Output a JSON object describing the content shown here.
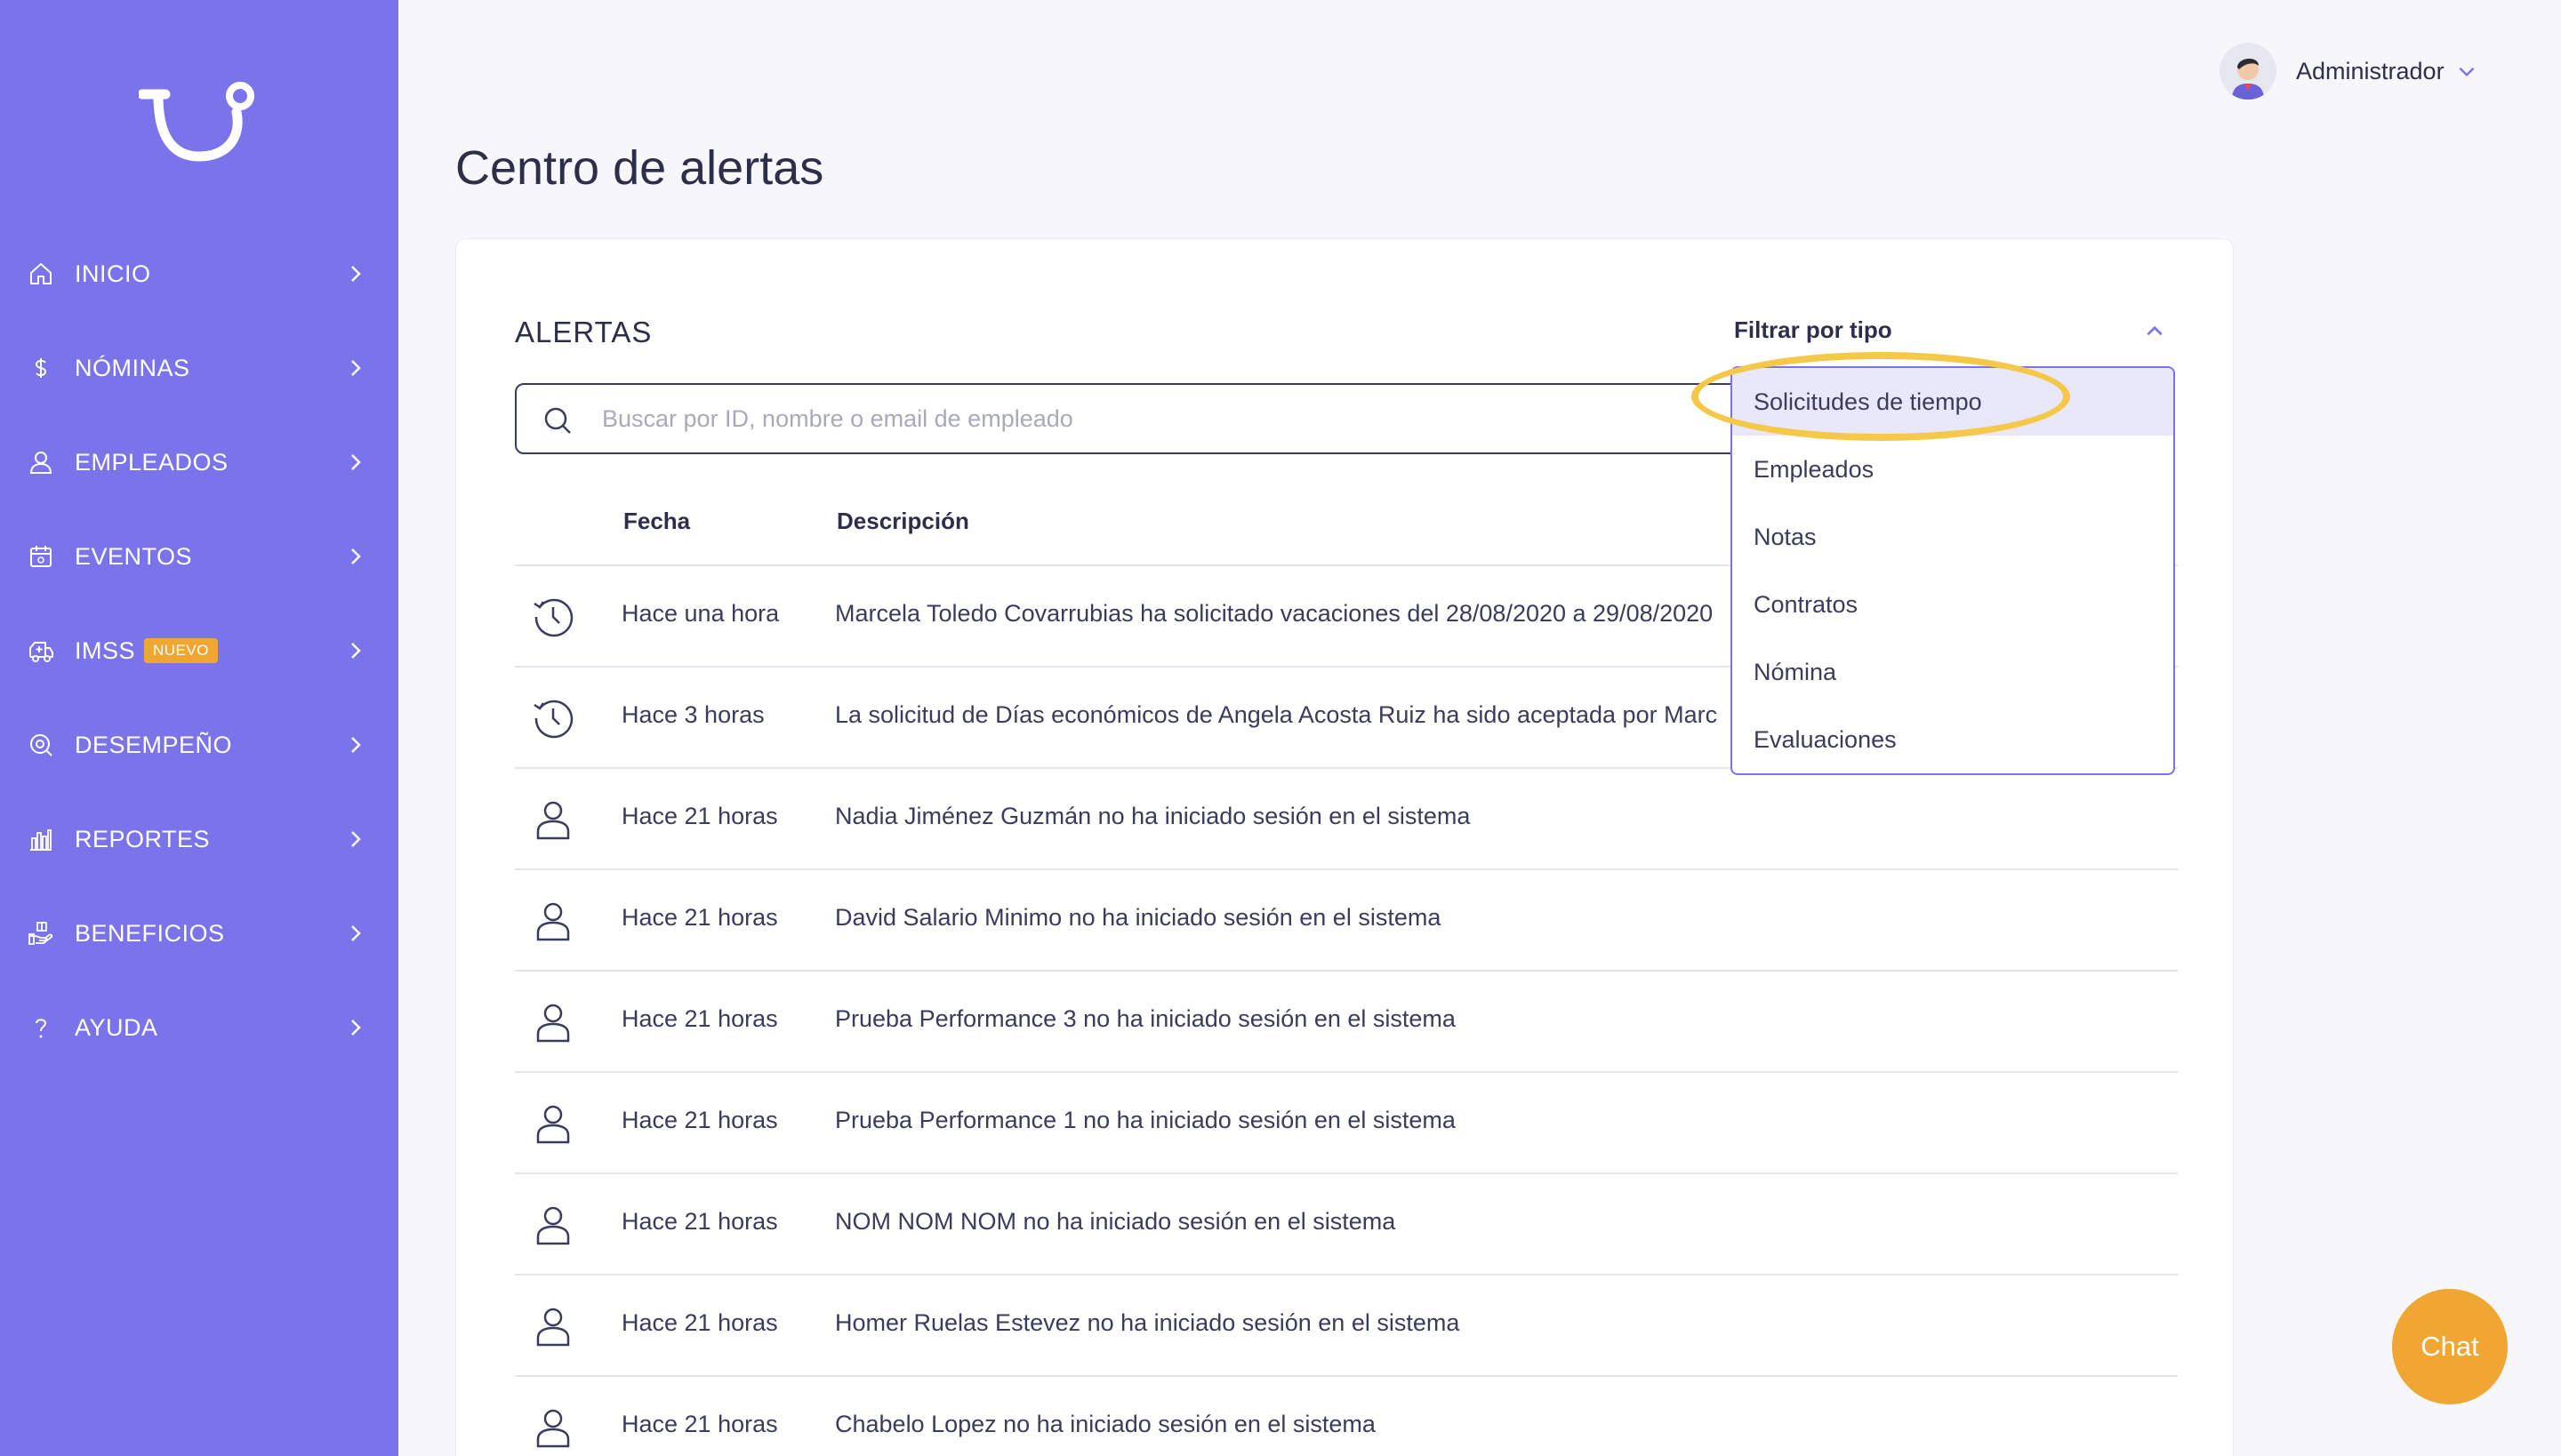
{
  "app": {
    "brand_color": "#7b73ea",
    "accent_color": "#f0a632",
    "highlight_color": "#f5c84a"
  },
  "sidebar": {
    "items": [
      {
        "label": "INICIO",
        "icon": "home-icon"
      },
      {
        "label": "NÓMINAS",
        "icon": "dollar-icon"
      },
      {
        "label": "EMPLEADOS",
        "icon": "user-icon"
      },
      {
        "label": "EVENTOS",
        "icon": "calendar-icon"
      },
      {
        "label": "IMSS",
        "icon": "ambulance-icon",
        "badge": "NUEVO"
      },
      {
        "label": "DESEMPEÑO",
        "icon": "target-icon"
      },
      {
        "label": "REPORTES",
        "icon": "bar-chart-icon"
      },
      {
        "label": "BENEFICIOS",
        "icon": "hand-gift-icon"
      },
      {
        "label": "AYUDA",
        "icon": "question-icon"
      }
    ]
  },
  "header": {
    "user_name": "Administrador"
  },
  "page": {
    "title": "Centro de alertas"
  },
  "alerts": {
    "title": "ALERTAS",
    "search_placeholder": "Buscar por ID, nombre o email de empleado",
    "columns": {
      "date": "Fecha",
      "description": "Descripción"
    },
    "rows": [
      {
        "icon": "clock-history-icon",
        "date": "Hace una hora",
        "description": "Marcela Toledo Covarrubias ha solicitado vacaciones del 28/08/2020 a 29/08/2020"
      },
      {
        "icon": "clock-history-icon",
        "date": "Hace 3 horas",
        "description": "La solicitud de Días económicos de Angela Acosta Ruiz ha sido aceptada por Marc"
      },
      {
        "icon": "user-icon",
        "date": "Hace 21 horas",
        "description": "Nadia Jiménez Guzmán no ha iniciado sesión en el sistema"
      },
      {
        "icon": "user-icon",
        "date": "Hace 21 horas",
        "description": "David Salario Minimo no ha iniciado sesión en el sistema"
      },
      {
        "icon": "user-icon",
        "date": "Hace 21 horas",
        "description": "Prueba Performance 3 no ha iniciado sesión en el sistema"
      },
      {
        "icon": "user-icon",
        "date": "Hace 21 horas",
        "description": "Prueba Performance 1 no ha iniciado sesión en el sistema"
      },
      {
        "icon": "user-icon",
        "date": "Hace 21 horas",
        "description": "NOM NOM NOM no ha iniciado sesión en el sistema"
      },
      {
        "icon": "user-icon",
        "date": "Hace 21 horas",
        "description": "Homer Ruelas Estevez no ha iniciado sesión en el sistema"
      },
      {
        "icon": "user-icon",
        "date": "Hace 21 horas",
        "description": "Chabelo Lopez no ha iniciado sesión en el sistema"
      }
    ]
  },
  "filter": {
    "label": "Filtrar por tipo",
    "options": [
      {
        "label": "Solicitudes de tiempo",
        "selected": true
      },
      {
        "label": "Empleados"
      },
      {
        "label": "Notas"
      },
      {
        "label": "Contratos"
      },
      {
        "label": "Nómina"
      },
      {
        "label": "Evaluaciones"
      }
    ]
  },
  "chat": {
    "label": "Chat"
  }
}
